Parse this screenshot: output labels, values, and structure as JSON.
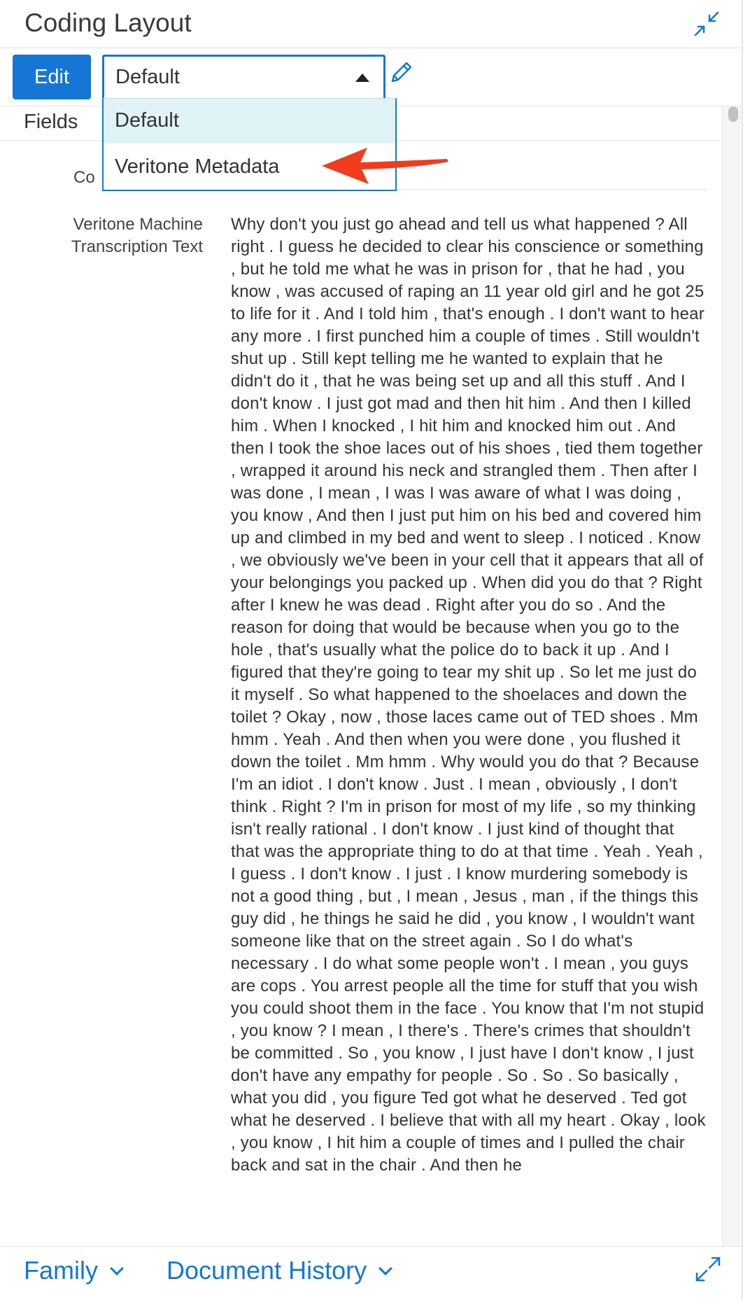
{
  "header": {
    "title": "Coding Layout",
    "collapse_icon": "collapse-arrows-icon"
  },
  "toolbar": {
    "edit_label": "Edit",
    "layout_select": {
      "value": "Default"
    },
    "edit_layout_icon": "pencil-icon"
  },
  "dropdown": {
    "options": [
      {
        "label": "Default",
        "highlighted": true
      },
      {
        "label": "Veritone Metadata",
        "highlighted": false
      }
    ]
  },
  "subheader": {
    "fields_label": "Fields"
  },
  "content": {
    "partial_label": "Co",
    "field": {
      "label_line1": "Veritone Machine",
      "label_line2": "Transcription Text",
      "value": "Why don't you just go ahead and tell us what happened ? All right . I guess he decided to clear his conscience or something , but he told me what he was in prison for , that he had , you know , was accused of raping an 11 year old girl and he got 25 to life for it . And I told him , that's enough . I don't want to hear any more . I first punched him a couple of times . Still wouldn't shut up . Still kept telling me he wanted to explain that he didn't do it , that he was being set up and all this stuff . And I don't know . I just got mad and then hit him . And then I killed him . When I knocked , I hit him and knocked him out . And then I took the shoe laces out of his shoes , tied them together , wrapped it around his neck and strangled them . Then after I was done , I mean , I was I was aware of what I was doing , you know , And then I just put him on his bed and covered him up and climbed in my bed and went to sleep . I noticed . Know , we obviously we've been in your cell that it appears that all of your belongings you packed up . When did you do that ? Right after I knew he was dead . Right after you do so . And the reason for doing that would be because when you go to the hole , that's usually what the police do to back it up . And I figured that they're going to tear my shit up . So let me just do it myself . So what happened to the shoelaces and down the toilet ? Okay , now , those laces came out of TED shoes . Mm hmm . Yeah . And then when you were done , you flushed it down the toilet . Mm hmm . Why would you do that ? Because I'm an idiot . I don't know . Just . I mean , obviously , I don't think . Right ? I'm in prison for most of my life , so my thinking isn't really rational . I don't know . I just kind of thought that that was the appropriate thing to do at that time . Yeah . Yeah , I guess . I don't know . I just . I know murdering somebody is not a good thing , but , I mean , Jesus , man , if the things this guy did , he things he said he did , you know , I wouldn't want someone like that on the street again . So I do what's necessary . I do what some people won't . I mean , you guys are cops . You arrest people all the time for stuff that you wish you could shoot them in the face . You know that I'm not stupid , you know ? I mean , I there's . There's crimes that shouldn't be committed . So , you know , I just have I don't know , I just don't have any empathy for people . So . So . So basically , what you did , you figure Ted got what he deserved . Ted got what he deserved . I believe that with all my heart . Okay , look , you know , I hit him a couple of times and I pulled the chair back and sat in the chair . And then he"
    }
  },
  "footer": {
    "tabs": [
      {
        "label": "Family",
        "icon": "chevron-down-icon"
      },
      {
        "label": "Document History",
        "icon": "chevron-down-icon"
      }
    ],
    "expand_icon": "expand-arrows-icon"
  },
  "colors": {
    "accent": "#1576d6",
    "highlight": "#dff3f7",
    "annotation_arrow": "#f23a1c"
  }
}
